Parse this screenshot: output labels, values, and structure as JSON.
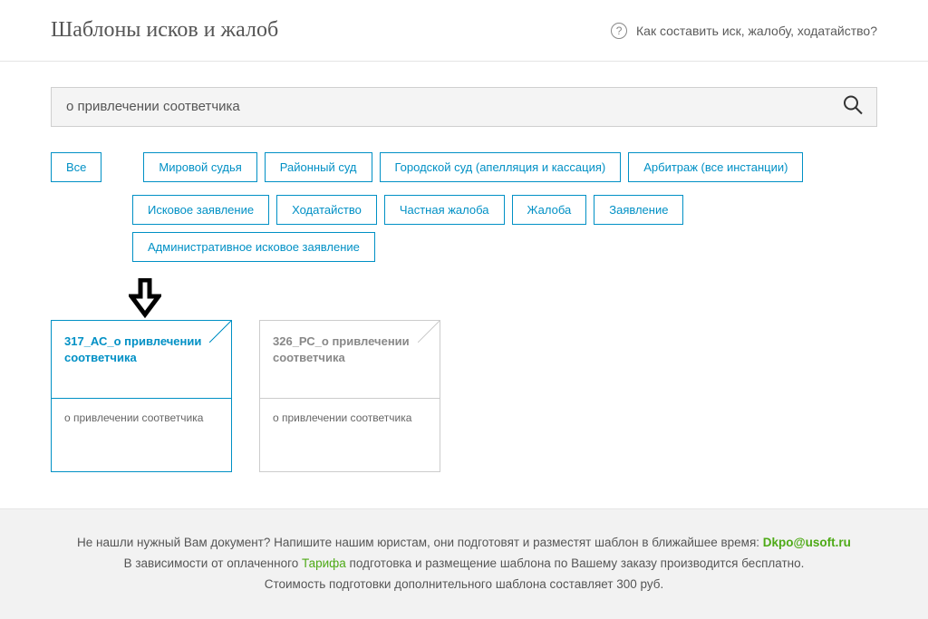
{
  "header": {
    "title": "Шаблоны исков и жалоб",
    "help": "Как составить иск, жалобу, ходатайство?"
  },
  "search": {
    "value": "о привлечении соответчика"
  },
  "filters_row1": [
    {
      "label": "Все"
    },
    {
      "label": "Мировой судья"
    },
    {
      "label": "Районный суд"
    },
    {
      "label": "Городской суд (апелляция и кассация)"
    },
    {
      "label": "Арбитраж (все инстанции)"
    }
  ],
  "filters_row2": [
    {
      "label": "Исковое заявление"
    },
    {
      "label": "Ходатайство"
    },
    {
      "label": "Частная жалоба"
    },
    {
      "label": "Жалоба"
    },
    {
      "label": "Заявление"
    },
    {
      "label": "Административное исковое заявление"
    }
  ],
  "results": [
    {
      "title": "317_АС_о привлечении соответчика",
      "desc": "о привлечении соответчика",
      "active": true
    },
    {
      "title": "326_РС_о привлечении соответчика",
      "desc": "о привлечении соответчика",
      "active": false
    }
  ],
  "footer": {
    "line1a": "Не нашли нужный Вам документ? Напишите нашим юристам, они подготовят и разместят шаблон в ближайшее время: ",
    "email": "Dkpo@usoft.ru",
    "line2a": "В зависимости от оплаченного  ",
    "tariff": "Тарифа",
    "line2b": " подготовка и размещение шаблона по Вашему заказу производится бесплатно.",
    "line3": "Стоимость подготовки дополнительного шаблона составляет 300 руб."
  }
}
